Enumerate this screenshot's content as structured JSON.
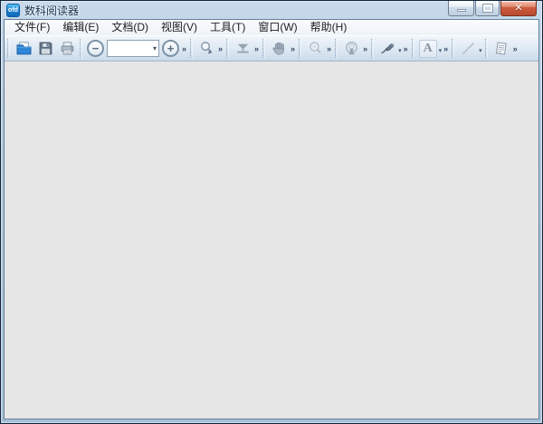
{
  "window": {
    "title": "数科阅读器",
    "app_icon_text": "ofd",
    "controls": {
      "close_glyph": "✕"
    }
  },
  "menu_bar": {
    "items": [
      {
        "label": "文件(F)"
      },
      {
        "label": "编辑(E)"
      },
      {
        "label": "文档(D)"
      },
      {
        "label": "视图(V)"
      },
      {
        "label": "工具(T)"
      },
      {
        "label": "窗口(W)"
      },
      {
        "label": "帮助(H)"
      }
    ]
  },
  "toolbar": {
    "overflow_chevron": "»",
    "dropdown_arrow": "▾",
    "zoom_out_glyph": "−",
    "zoom_in_glyph": "+",
    "zoom_combo_value": "",
    "text_tool_glyph": "A",
    "icon_names": [
      "open-icon",
      "save-icon",
      "print-icon",
      "zoom-out-icon",
      "zoom-in-icon",
      "marquee-zoom-icon",
      "fit-page-icon",
      "hand-icon",
      "magnifier-icon",
      "read-aloud-icon",
      "pen-icon",
      "text-tool-icon",
      "line-tool-icon",
      "note-icon"
    ]
  },
  "colors": {
    "titlebar_top": "#c7daeb",
    "titlebar_bottom": "#a6c0d7",
    "frame_outer": "#10243a",
    "menu_bg": "#f3f6f9",
    "toolbar_top": "#f0f5fa",
    "toolbar_bottom": "#ccdbea",
    "content_bg": "#e6e6e6",
    "close_button_red": "#cd5c40",
    "accent_blue": "#1b7fd2"
  }
}
